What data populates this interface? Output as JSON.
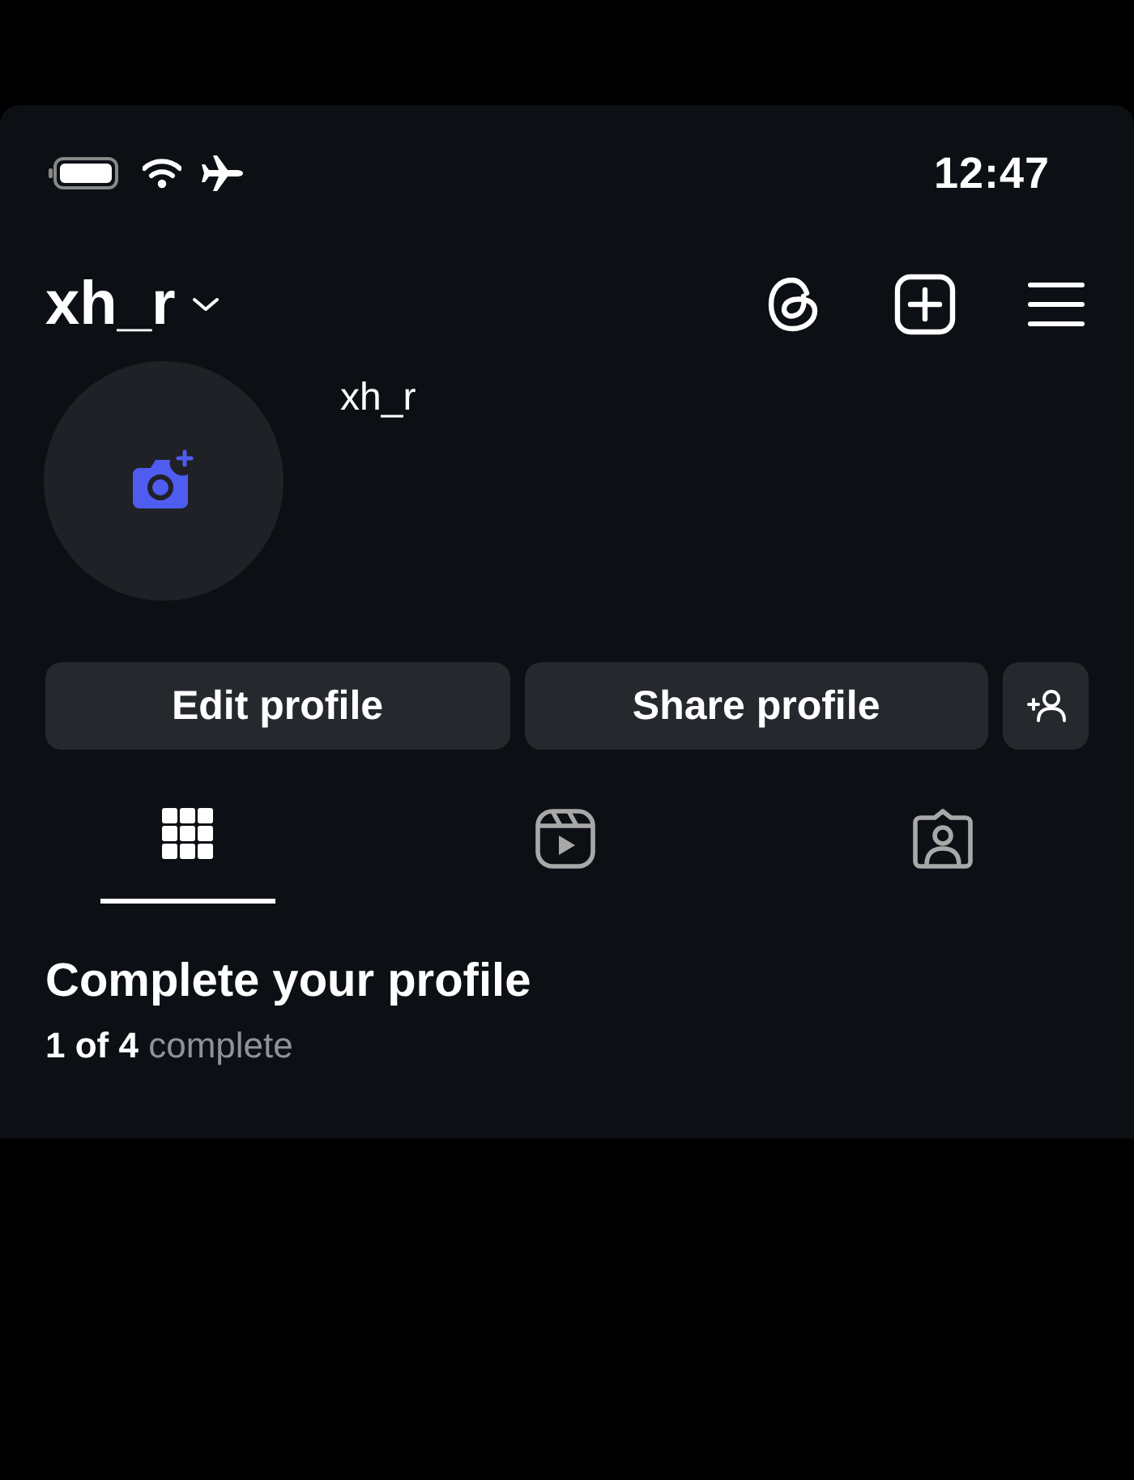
{
  "status_bar": {
    "time": "12:47"
  },
  "header": {
    "username": "xh_r"
  },
  "profile": {
    "name": "xh_r"
  },
  "buttons": [
    "Edit profile",
    "Share profile"
  ],
  "tabs": [
    {
      "kind": "grid",
      "selected": true
    },
    {
      "kind": "reels",
      "selected": false
    },
    {
      "kind": "tagged",
      "selected": false
    }
  ],
  "completion": {
    "title": "Complete your profile",
    "progress": "**1 of 4** complete"
  }
}
